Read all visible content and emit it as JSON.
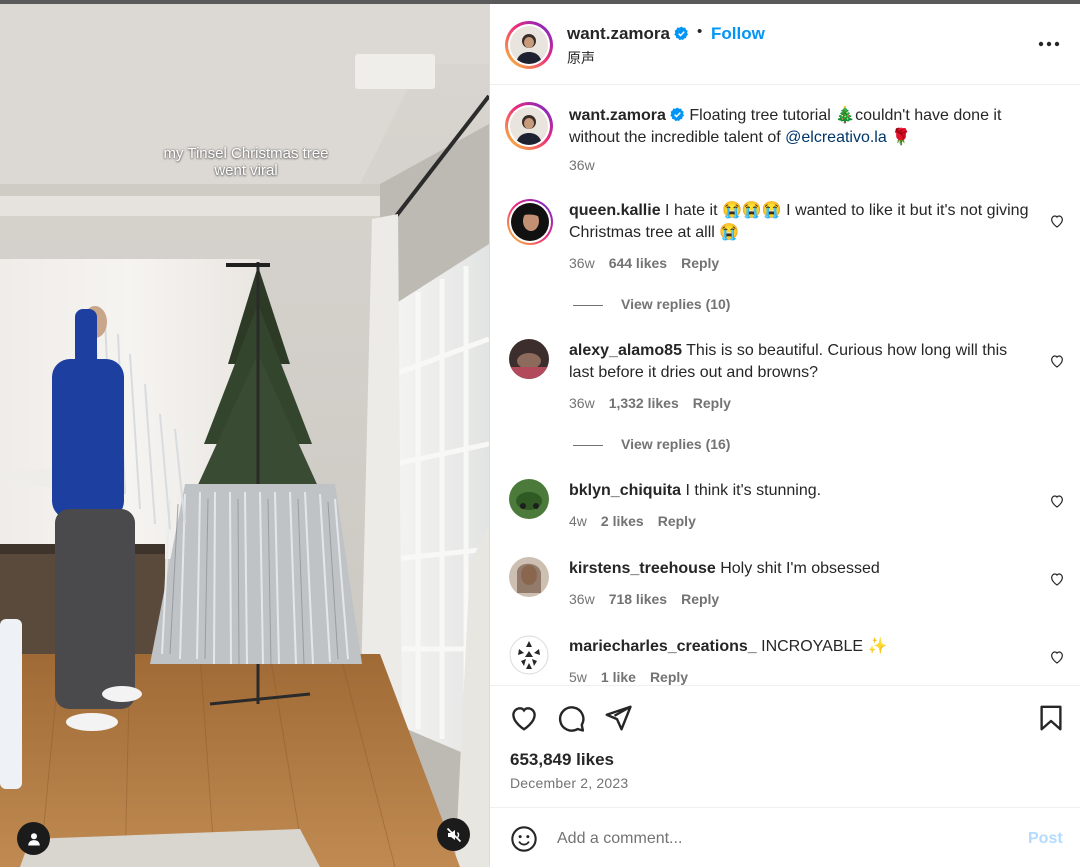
{
  "video": {
    "caption_line1": "my Tinsel Christmas tree",
    "caption_line2": "went viral"
  },
  "header": {
    "username": "want.zamora",
    "separator": "•",
    "follow_label": "Follow",
    "audio_label": "原声"
  },
  "caption": {
    "username": "want.zamora",
    "text_before": "Floating tree tutorial 🎄couldn't have done it without the incredible talent of ",
    "mention": "@elcreativo.la",
    "text_after": " 🌹",
    "age": "36w"
  },
  "comments": [
    {
      "username": "queen.kallie",
      "text": "I hate it 😭😭😭 I wanted to like it but it's not giving Christmas tree at alll 😭",
      "age": "36w",
      "likes": "644 likes",
      "reply": "Reply",
      "view_replies": "View replies (10)"
    },
    {
      "username": "alexy_alamo85",
      "text": "This is so beautiful. Curious how long will this last before it dries out and browns?",
      "age": "36w",
      "likes": "1,332 likes",
      "reply": "Reply",
      "view_replies": "View replies (16)"
    },
    {
      "username": "bklyn_chiquita",
      "text": "I think it's stunning.",
      "age": "4w",
      "likes": "2 likes",
      "reply": "Reply"
    },
    {
      "username": "kirstens_treehouse",
      "text": "Holy shit I'm obsessed",
      "age": "36w",
      "likes": "718 likes",
      "reply": "Reply"
    },
    {
      "username": "mariecharles_creations_",
      "text": "INCROYABLE ✨",
      "age": "5w",
      "likes": "1 like",
      "reply": "Reply"
    }
  ],
  "engagement": {
    "likes": "653,849 likes",
    "date": "December 2, 2023"
  },
  "composer": {
    "placeholder": "Add a comment...",
    "post_label": "Post"
  },
  "icons": {
    "verified": "verified-badge-icon",
    "more": "more-horizontal-icon",
    "like": "heart-icon",
    "comment": "comment-bubble-icon",
    "share": "paper-plane-icon",
    "save": "bookmark-icon",
    "emoji": "emoji-smile-icon",
    "user_tag": "person-icon",
    "mute": "speaker-muted-icon"
  },
  "colors": {
    "accent": "#0095f6",
    "verified": "#0095f6",
    "mention": "#00376b",
    "muted_text": "#737373",
    "post_disabled": "#b3dbff"
  }
}
